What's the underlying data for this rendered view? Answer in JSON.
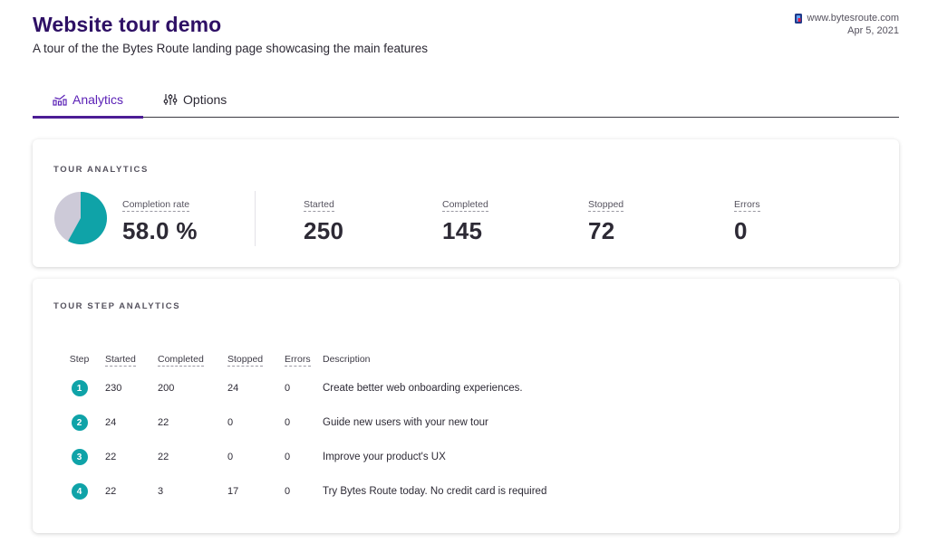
{
  "header": {
    "title": "Website tour demo",
    "subtitle": "A tour of the the Bytes Route landing page showcasing the main features",
    "site": "www.bytesroute.com",
    "date": "Apr 5, 2021"
  },
  "tabs": [
    {
      "label": "Analytics",
      "icon": "analytics-icon",
      "active": true
    },
    {
      "label": "Options",
      "icon": "sliders-icon",
      "active": false
    }
  ],
  "tour_analytics": {
    "title": "TOUR ANALYTICS",
    "completion_rate_label": "Completion rate",
    "completion_rate": "58.0 %",
    "completion_fraction": 0.58,
    "stats": [
      {
        "label": "Started",
        "value": "250"
      },
      {
        "label": "Completed",
        "value": "145"
      },
      {
        "label": "Stopped",
        "value": "72"
      },
      {
        "label": "Errors",
        "value": "0"
      }
    ]
  },
  "step_analytics": {
    "title": "TOUR STEP ANALYTICS",
    "columns": {
      "step": "Step",
      "started": "Started",
      "completed": "Completed",
      "stopped": "Stopped",
      "errors": "Errors",
      "description": "Description"
    },
    "rows": [
      {
        "step": "1",
        "started": "230",
        "completed": "200",
        "stopped": "24",
        "errors": "0",
        "description": "Create better web onboarding experiences."
      },
      {
        "step": "2",
        "started": "24",
        "completed": "22",
        "stopped": "0",
        "errors": "0",
        "description": "Guide new users with your new tour"
      },
      {
        "step": "3",
        "started": "22",
        "completed": "22",
        "stopped": "0",
        "errors": "0",
        "description": "Improve your product's UX"
      },
      {
        "step": "4",
        "started": "22",
        "completed": "3",
        "stopped": "17",
        "errors": "0",
        "description": "Try Bytes Route today. No credit card is required"
      }
    ]
  },
  "colors": {
    "accent": "#4c1d95",
    "teal": "#0fa3a8",
    "pie_rest": "#cdcad8"
  }
}
